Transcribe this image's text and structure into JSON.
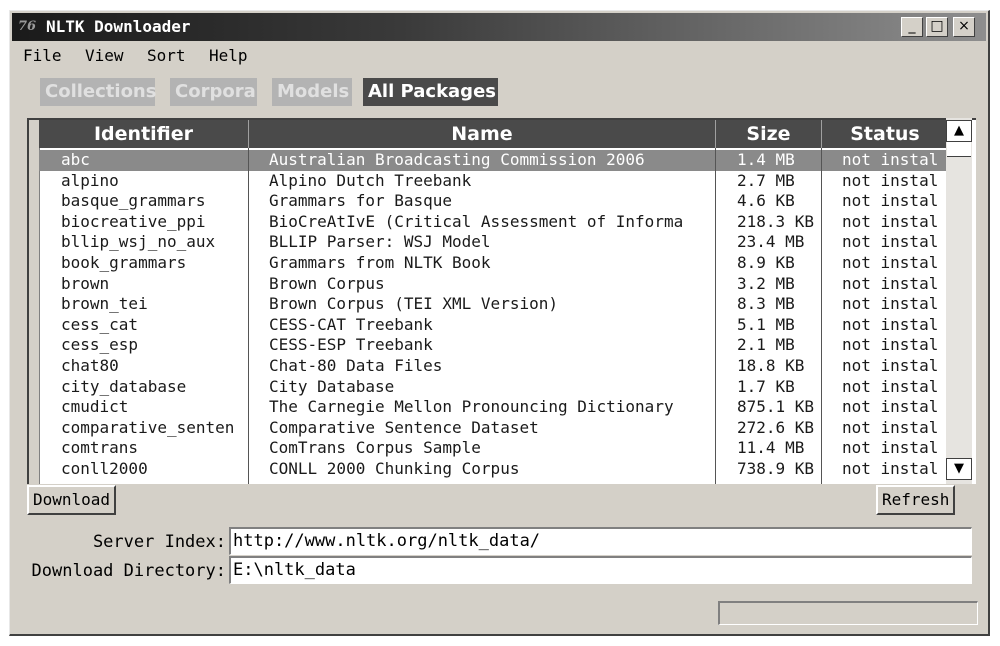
{
  "window": {
    "title": "NLTK Downloader",
    "icon_text": "76",
    "controls": {
      "minimize": "_",
      "maximize": "□",
      "close": "×"
    }
  },
  "menu": [
    "File",
    "View",
    "Sort",
    "Help"
  ],
  "tabs": [
    {
      "label": "Collections",
      "active": false
    },
    {
      "label": "Corpora",
      "active": false
    },
    {
      "label": "Models",
      "active": false
    },
    {
      "label": "All Packages",
      "active": true
    }
  ],
  "table": {
    "columns": [
      "Identifier",
      "Name",
      "Size",
      "Status"
    ],
    "selected_index": 0,
    "rows": [
      [
        "abc",
        "Australian Broadcasting Commission 2006",
        "1.4 MB",
        "not instal"
      ],
      [
        "alpino",
        "Alpino Dutch Treebank",
        "2.7 MB",
        "not instal"
      ],
      [
        "basque_grammars",
        "Grammars for Basque",
        "4.6 KB",
        "not instal"
      ],
      [
        "biocreative_ppi",
        "BioCreAtIvE (Critical Assessment of Informa",
        "218.3 KB",
        "not instal"
      ],
      [
        "bllip_wsj_no_aux",
        "BLLIP Parser: WSJ Model",
        "23.4 MB",
        "not instal"
      ],
      [
        "book_grammars",
        "Grammars from NLTK Book",
        "8.9 KB",
        "not instal"
      ],
      [
        "brown",
        "Brown Corpus",
        "3.2 MB",
        "not instal"
      ],
      [
        "brown_tei",
        "Brown Corpus (TEI XML Version)",
        "8.3 MB",
        "not instal"
      ],
      [
        "cess_cat",
        "CESS-CAT Treebank",
        "5.1 MB",
        "not instal"
      ],
      [
        "cess_esp",
        "CESS-ESP Treebank",
        "2.1 MB",
        "not instal"
      ],
      [
        "chat80",
        "Chat-80 Data Files",
        "18.8 KB",
        "not instal"
      ],
      [
        "city_database",
        "City Database",
        "1.7 KB",
        "not instal"
      ],
      [
        "cmudict",
        "The Carnegie Mellon Pronouncing Dictionary",
        "875.1 KB",
        "not instal"
      ],
      [
        "comparative_senten",
        "Comparative Sentence Dataset",
        "272.6 KB",
        "not instal"
      ],
      [
        "comtrans",
        "ComTrans Corpus Sample",
        "11.4 MB",
        "not instal"
      ],
      [
        "conll2000",
        "CONLL 2000 Chunking Corpus",
        "738.9 KB",
        "not instal"
      ]
    ]
  },
  "scrollbar": {
    "up": "▲",
    "down": "▼"
  },
  "buttons": {
    "download": "Download",
    "refresh": "Refresh"
  },
  "server_index": {
    "label": "Server Index:",
    "value": "http://www.nltk.org/nltk_data/"
  },
  "download_directory": {
    "label": "Download Directory:",
    "value": "E:\\nltk_data"
  },
  "progress": {
    "fraction": 0
  }
}
